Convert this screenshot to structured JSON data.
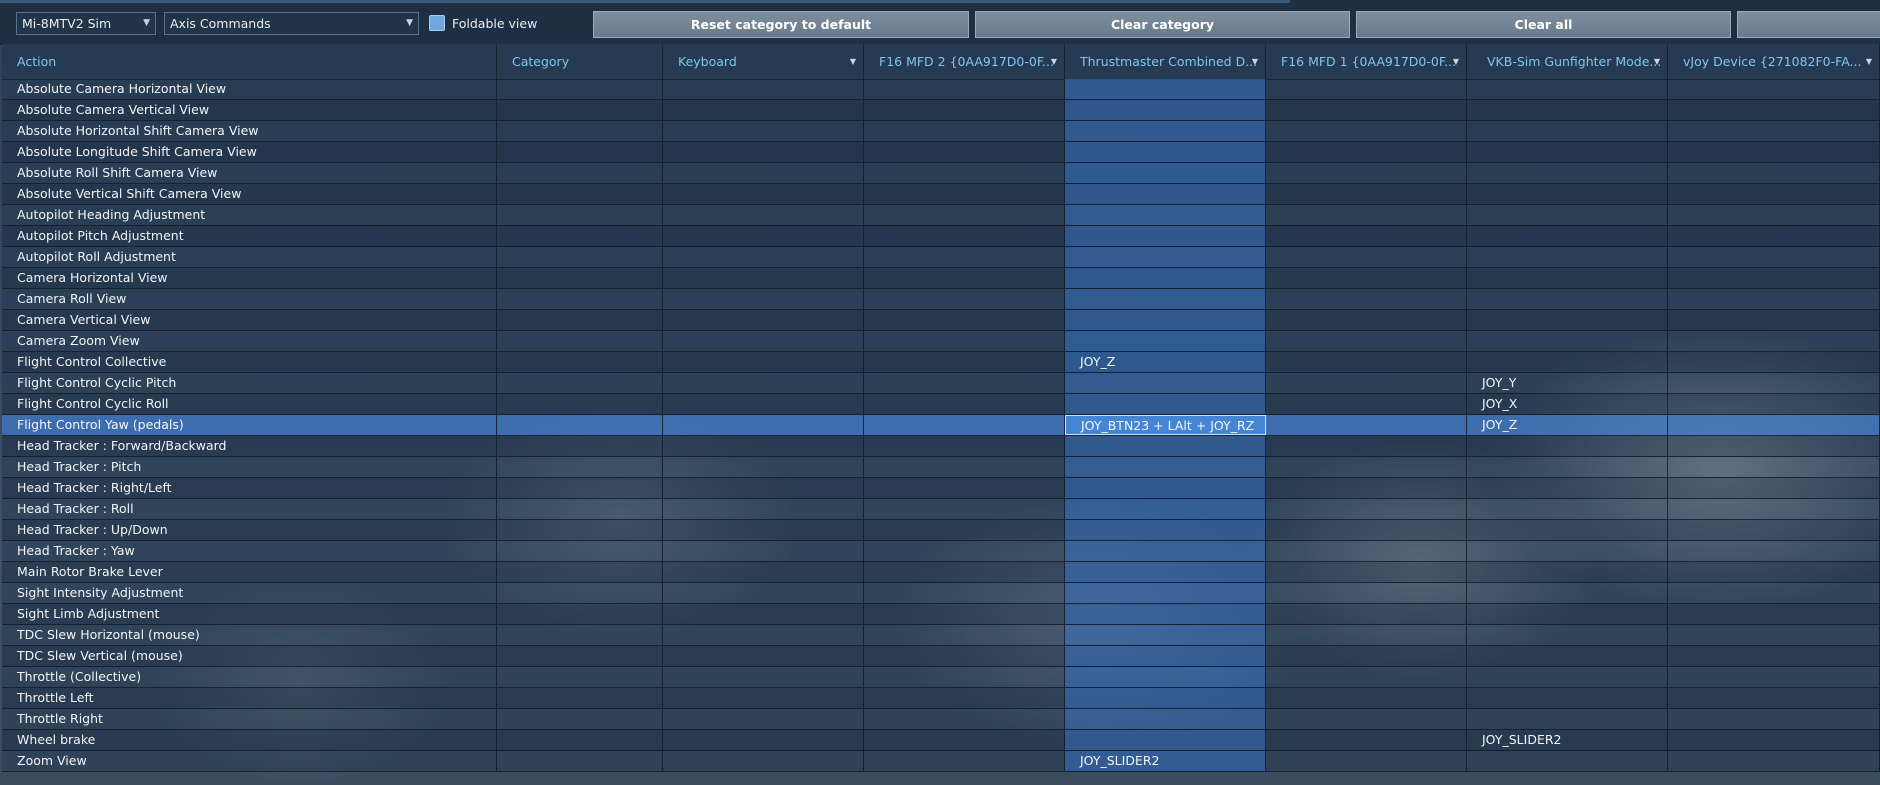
{
  "toolbar": {
    "aircraft_select": "Mi-8MTV2 Sim",
    "category_select": "Axis Commands",
    "foldable_label": "Foldable view",
    "reset_button": "Reset category to default",
    "clear_category_button": "Clear category",
    "clear_all_button": "Clear all"
  },
  "columns": [
    "Action",
    "Category",
    "Keyboard",
    "F16 MFD 2 {0AA917D0-0F...",
    "Thrustmaster Combined D...",
    "F16 MFD 1 {0AA917D0-0F...",
    "VKB-Sim Gunfighter Mode...",
    "vJoy Device {271082F0-FA..."
  ],
  "rows": [
    [
      "Absolute Camera Horizontal View",
      "",
      "",
      "",
      "",
      "",
      "",
      ""
    ],
    [
      "Absolute Camera Vertical View",
      "",
      "",
      "",
      "",
      "",
      "",
      ""
    ],
    [
      "Absolute Horizontal Shift Camera View",
      "",
      "",
      "",
      "",
      "",
      "",
      ""
    ],
    [
      "Absolute Longitude Shift Camera View",
      "",
      "",
      "",
      "",
      "",
      "",
      ""
    ],
    [
      "Absolute Roll Shift Camera View",
      "",
      "",
      "",
      "",
      "",
      "",
      ""
    ],
    [
      "Absolute Vertical Shift Camera View",
      "",
      "",
      "",
      "",
      "",
      "",
      ""
    ],
    [
      "Autopilot Heading Adjustment",
      "",
      "",
      "",
      "",
      "",
      "",
      ""
    ],
    [
      "Autopilot Pitch Adjustment",
      "",
      "",
      "",
      "",
      "",
      "",
      ""
    ],
    [
      "Autopilot Roll Adjustment",
      "",
      "",
      "",
      "",
      "",
      "",
      ""
    ],
    [
      "Camera Horizontal View",
      "",
      "",
      "",
      "",
      "",
      "",
      ""
    ],
    [
      "Camera Roll View",
      "",
      "",
      "",
      "",
      "",
      "",
      ""
    ],
    [
      "Camera Vertical View",
      "",
      "",
      "",
      "",
      "",
      "",
      ""
    ],
    [
      "Camera Zoom View",
      "",
      "",
      "",
      "",
      "",
      "",
      ""
    ],
    [
      "Flight Control Collective",
      "",
      "",
      "",
      "JOY_Z",
      "",
      "",
      ""
    ],
    [
      "Flight Control Cyclic Pitch",
      "",
      "",
      "",
      "",
      "",
      "JOY_Y",
      ""
    ],
    [
      "Flight Control Cyclic Roll",
      "",
      "",
      "",
      "",
      "",
      "JOY_X",
      ""
    ],
    [
      "Flight Control Yaw (pedals)",
      "",
      "",
      "",
      "JOY_BTN23 + LAlt + JOY_RZ",
      "",
      "JOY_Z",
      ""
    ],
    [
      "Head Tracker : Forward/Backward",
      "",
      "",
      "",
      "",
      "",
      "",
      ""
    ],
    [
      "Head Tracker : Pitch",
      "",
      "",
      "",
      "",
      "",
      "",
      ""
    ],
    [
      "Head Tracker : Right/Left",
      "",
      "",
      "",
      "",
      "",
      "",
      ""
    ],
    [
      "Head Tracker : Roll",
      "",
      "",
      "",
      "",
      "",
      "",
      ""
    ],
    [
      "Head Tracker : Up/Down",
      "",
      "",
      "",
      "",
      "",
      "",
      ""
    ],
    [
      "Head Tracker : Yaw",
      "",
      "",
      "",
      "",
      "",
      "",
      ""
    ],
    [
      "Main Rotor Brake Lever",
      "",
      "",
      "",
      "",
      "",
      "",
      ""
    ],
    [
      "Sight Intensity Adjustment",
      "",
      "",
      "",
      "",
      "",
      "",
      ""
    ],
    [
      "Sight Limb Adjustment",
      "",
      "",
      "",
      "",
      "",
      "",
      ""
    ],
    [
      "TDC Slew Horizontal (mouse)",
      "",
      "",
      "",
      "",
      "",
      "",
      ""
    ],
    [
      "TDC Slew Vertical (mouse)",
      "",
      "",
      "",
      "",
      "",
      "",
      ""
    ],
    [
      "Throttle (Collective)",
      "",
      "",
      "",
      "",
      "",
      "",
      ""
    ],
    [
      "Throttle Left",
      "",
      "",
      "",
      "",
      "",
      "",
      ""
    ],
    [
      "Throttle Right",
      "",
      "",
      "",
      "",
      "",
      "",
      ""
    ],
    [
      "Wheel brake",
      "",
      "",
      "",
      "",
      "",
      "JOY_SLIDER2",
      ""
    ],
    [
      "Zoom View",
      "",
      "",
      "",
      "JOY_SLIDER2",
      "",
      "",
      ""
    ]
  ],
  "selected_row": "Flight Control Yaw (pedals)",
  "highlighted_column": "Thrustmaster Combined D...",
  "colors": {
    "header_text": "#7fc5f0",
    "selection": "#3e76be",
    "button": "#74879a"
  }
}
